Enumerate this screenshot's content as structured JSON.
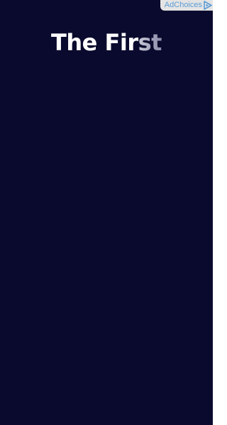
{
  "ad": {
    "headline": {
      "solid_text": "The Fir",
      "fading_text": "st"
    },
    "adchoices": {
      "label": "AdChoices",
      "icon": "adchoices-triangle-icon"
    }
  },
  "colors": {
    "background": "#0a0a2e",
    "headline": "#ffffff",
    "adchoices_bg": "#e4e4e4",
    "adchoices_accent": "#5a9bd5"
  }
}
